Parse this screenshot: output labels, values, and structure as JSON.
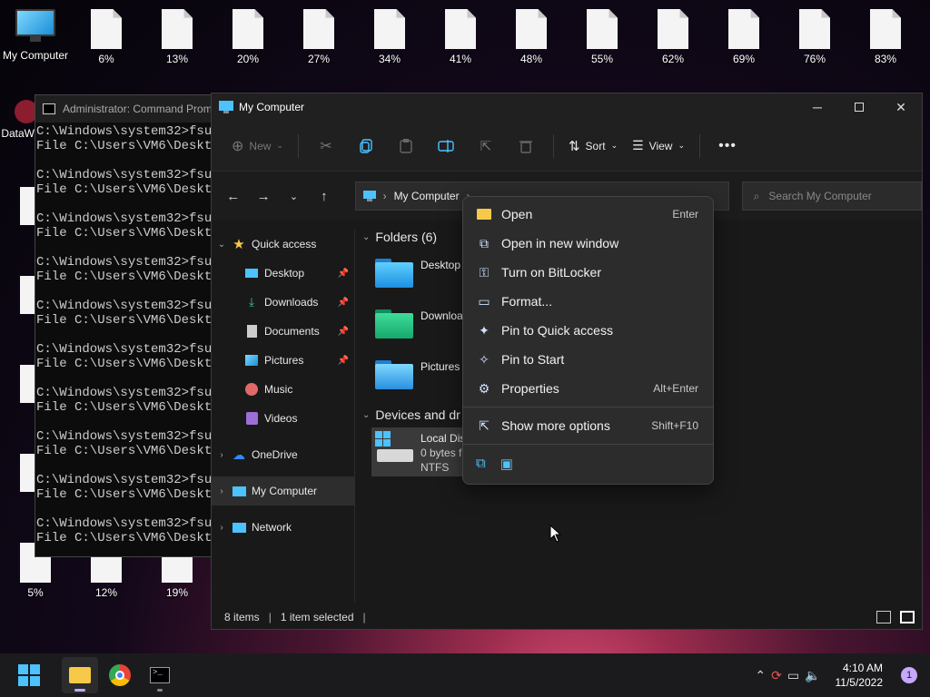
{
  "desktop": {
    "my_computer_label": "My Computer",
    "top_files": [
      "6%",
      "13%",
      "20%",
      "27%",
      "34%",
      "41%",
      "48%",
      "55%",
      "62%",
      "69%",
      "76%",
      "83%"
    ],
    "bottom_files": [
      "5%",
      "12%",
      "19%"
    ],
    "partial_label": "DataW"
  },
  "cmd": {
    "title": "Administrator: Command Prom",
    "lines": [
      "C:\\Windows\\system32>fsut",
      "File C:\\Users\\VM6\\Deskto",
      "",
      "C:\\Windows\\system32>fsut",
      "File C:\\Users\\VM6\\Deskto",
      "",
      "C:\\Windows\\system32>fsut",
      "File C:\\Users\\VM6\\Deskto",
      "",
      "C:\\Windows\\system32>fsut",
      "File C:\\Users\\VM6\\Deskto",
      "",
      "C:\\Windows\\system32>fsut",
      "File C:\\Users\\VM6\\Deskto",
      "",
      "C:\\Windows\\system32>fsut",
      "File C:\\Users\\VM6\\Deskto",
      "",
      "C:\\Windows\\system32>fsut",
      "File C:\\Users\\VM6\\Deskto",
      "",
      "C:\\Windows\\system32>fsut",
      "File C:\\Users\\VM6\\Deskto",
      "",
      "C:\\Windows\\system32>fsut",
      "File C:\\Users\\VM6\\Deskto",
      "",
      "C:\\Windows\\system32>fsut",
      "File C:\\Users\\VM6\\Deskto"
    ]
  },
  "explorer": {
    "title": "My Computer",
    "toolbar": {
      "new": "New",
      "sort": "Sort",
      "view": "View"
    },
    "address": "My Computer",
    "search_placeholder": "Search My Computer",
    "nav": {
      "quick_access": "Quick access",
      "desktop": "Desktop",
      "downloads": "Downloads",
      "documents": "Documents",
      "pictures": "Pictures",
      "music": "Music",
      "videos": "Videos",
      "onedrive": "OneDrive",
      "my_computer": "My Computer",
      "network": "Network"
    },
    "content": {
      "folders_header": "Folders (6)",
      "devices_header": "Devices and dr",
      "folder_desktop": "Desktop",
      "folder_downloads": "Downloa",
      "folder_pictures": "Pictures",
      "drive_name": "Local Dis",
      "drive_free": "0 bytes f",
      "drive_fs": "NTFS"
    },
    "status": {
      "items": "8 items",
      "selected": "1 item selected"
    }
  },
  "context_menu": {
    "open": "Open",
    "open_accel": "Enter",
    "open_new_window": "Open in new window",
    "bitlocker": "Turn on BitLocker",
    "format": "Format...",
    "pin_quick": "Pin to Quick access",
    "pin_start": "Pin to Start",
    "properties": "Properties",
    "properties_accel": "Alt+Enter",
    "more_options": "Show more options",
    "more_options_accel": "Shift+F10"
  },
  "taskbar": {
    "time": "4:10 AM",
    "date": "11/5/2022",
    "notification_count": "1"
  }
}
